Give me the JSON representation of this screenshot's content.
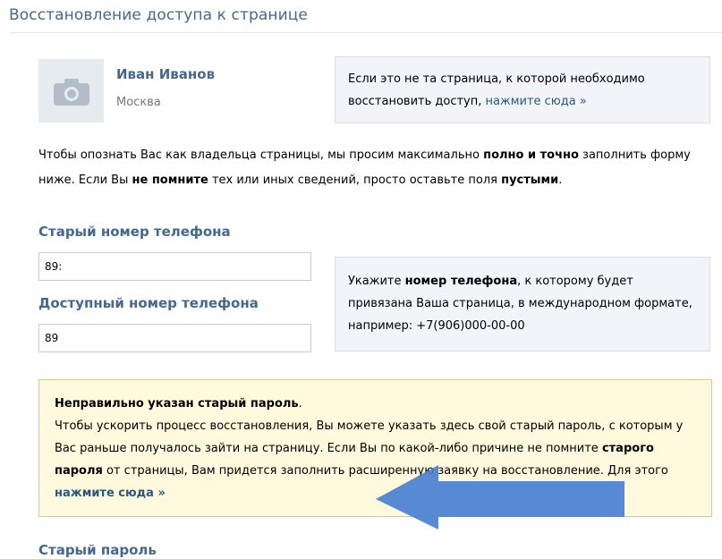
{
  "page": {
    "title": "Восстановление доступа к странице"
  },
  "profile": {
    "name": "Иван Иванов",
    "city": "Москва",
    "avatar_icon": "camera-icon"
  },
  "wrong_page": {
    "text": "Если это не та страница, к которой необходимо восстановить доступ,",
    "link_text": "нажмите сюда »"
  },
  "intro": {
    "part1": "Чтобы опознать Вас как владельца страницы, мы просим максимально",
    "bold1": "полно и точно",
    "part2": "заполнить форму ниже. Если Вы",
    "bold2": "не помните",
    "part3": "тех или иных сведений, просто оставьте поля",
    "bold3": "пустыми",
    "part4": "."
  },
  "form": {
    "old_phone_label": "Старый номер телефона",
    "old_phone_value": "89:",
    "available_phone_label": "Доступный номер телефона",
    "available_phone_value": "89",
    "old_password_label": "Старый пароль"
  },
  "phone_hint": {
    "part1": "Укажите",
    "bold": "номер телефона",
    "part2": ", к которому будет привязана Ваша страница, в международном формате, например: +7(906)000-00-00"
  },
  "warning": {
    "title": "Неправильно указан старый пароль",
    "title_suffix": ".",
    "part1": "Чтобы ускорить процесс восстановления, Вы можете указать здесь свой старый пароль, с которым у Вас раньше получалось зайти на страницу. Если Вы по какой-либо причине не помните",
    "bold": "старого пароля",
    "part2": "от страницы, Вам придется заполнить расширенную заявку на восстановление. Для этого",
    "link_text": "нажмите сюда »"
  },
  "colors": {
    "accent": "#45688e",
    "link": "#2b587a",
    "info_bg": "#f2f4f7",
    "warning_bg": "#fff9dd",
    "warning_border": "#d9c88c",
    "annotation_arrow": "#4a7fd4"
  },
  "annotation": {
    "arrow_icon": "arrow-left-icon"
  }
}
